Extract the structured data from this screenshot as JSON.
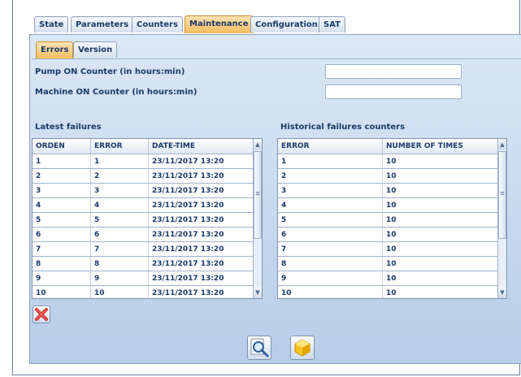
{
  "tabs": [
    {
      "label": "State"
    },
    {
      "label": "Parameters"
    },
    {
      "label": "Counters"
    },
    {
      "label": "Maintenance"
    },
    {
      "label": "Configuration"
    },
    {
      "label": "SAT"
    }
  ],
  "active_tab": "Maintenance",
  "subtabs": [
    {
      "label": "Errors"
    },
    {
      "label": "Version"
    }
  ],
  "active_subtab": "Errors",
  "counters": {
    "pump_label": "Pump ON Counter (in hours:min)",
    "pump_value": "",
    "machine_label": "Machine ON Counter (in hours:min)",
    "machine_value": ""
  },
  "latest": {
    "title": "Latest failures",
    "headers": [
      "ORDEN",
      "ERROR",
      "DATE-TIME"
    ],
    "rows": [
      [
        "1",
        "1",
        "23/11/2017 13:20"
      ],
      [
        "2",
        "2",
        "23/11/2017 13:20"
      ],
      [
        "3",
        "3",
        "23/11/2017 13:20"
      ],
      [
        "4",
        "4",
        "23/11/2017 13:20"
      ],
      [
        "5",
        "5",
        "23/11/2017 13:20"
      ],
      [
        "6",
        "6",
        "23/11/2017 13:20"
      ],
      [
        "7",
        "7",
        "23/11/2017 13:20"
      ],
      [
        "8",
        "8",
        "23/11/2017 13:20"
      ],
      [
        "9",
        "9",
        "23/11/2017 13:20"
      ],
      [
        "10",
        "10",
        "23/11/2017 13:20"
      ]
    ]
  },
  "historical": {
    "title": "Historical failures counters",
    "headers": [
      "ERROR",
      "NUMBER OF TIMES"
    ],
    "rows": [
      [
        "1",
        "10"
      ],
      [
        "2",
        "10"
      ],
      [
        "3",
        "10"
      ],
      [
        "4",
        "10"
      ],
      [
        "5",
        "10"
      ],
      [
        "6",
        "10"
      ],
      [
        "7",
        "10"
      ],
      [
        "8",
        "10"
      ],
      [
        "9",
        "10"
      ],
      [
        "10",
        "10"
      ]
    ]
  },
  "icons": {
    "delete": "red-x-icon",
    "search": "magnifier-icon",
    "reset": "yellow-gem-icon"
  },
  "colors": {
    "active_tab": "#f6bb5b",
    "panel": "#c6d8ee",
    "text": "#1a3a6a",
    "delete_icon": "#e03030"
  }
}
